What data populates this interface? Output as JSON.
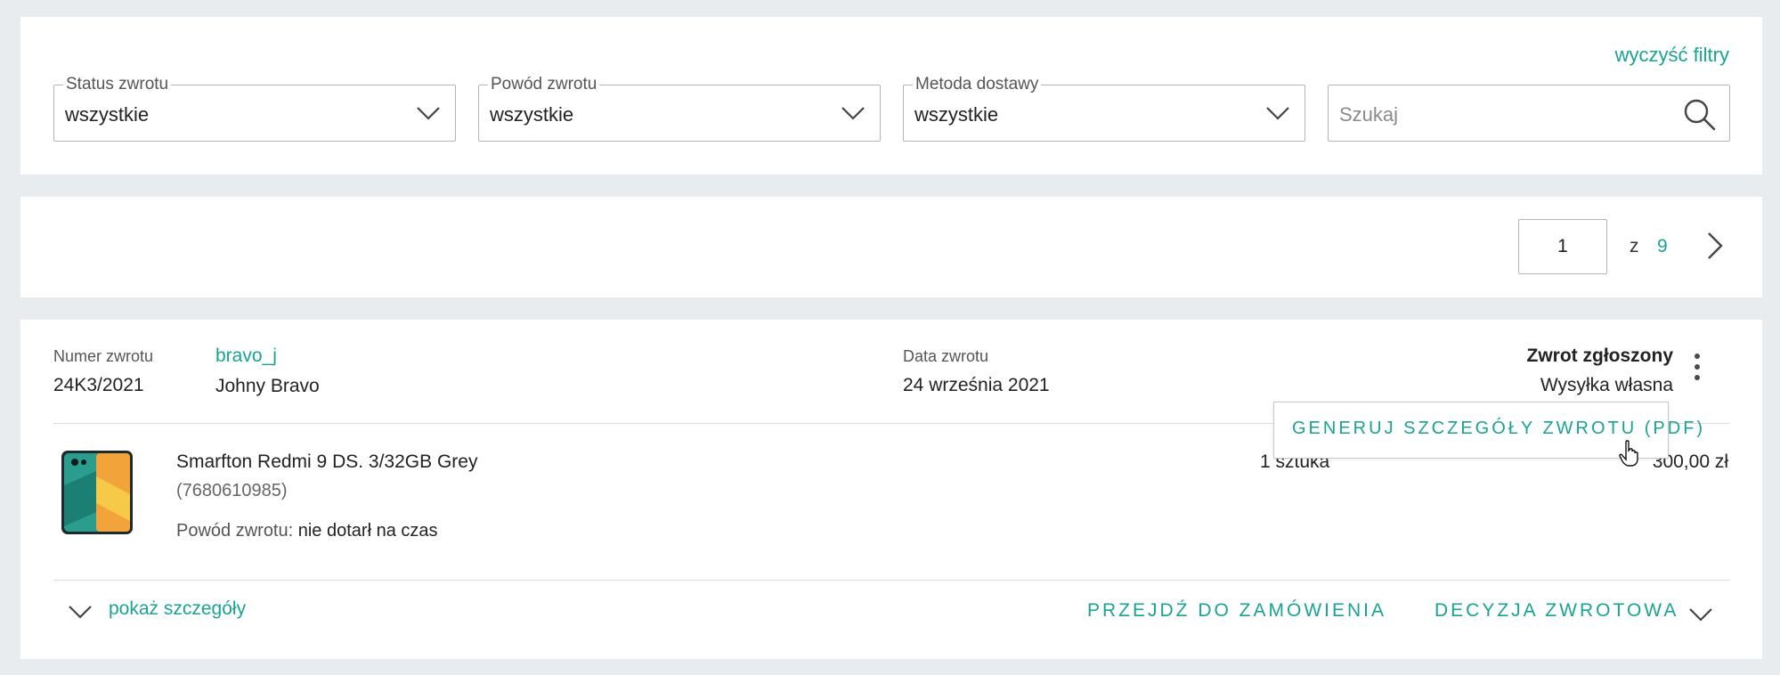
{
  "filters": {
    "clear_label": "wyczyść filtry",
    "status": {
      "label": "Status zwrotu",
      "value": "wszystkie"
    },
    "reason": {
      "label": "Powód zwrotu",
      "value": "wszystkie"
    },
    "delivery": {
      "label": "Metoda dostawy",
      "value": "wszystkie"
    },
    "search": {
      "placeholder": "Szukaj"
    }
  },
  "pagination": {
    "current": "1",
    "of_label": "z",
    "total": "9"
  },
  "return_item": {
    "number_label": "Numer zwrotu",
    "number": "24K3/2021",
    "username": "bravo_j",
    "customer_name": "Johny Bravo",
    "date_label": "Data zwrotu",
    "date": "24 września 2021",
    "status": "Zwrot zgłoszony",
    "shipping": "Wysyłka własna",
    "menu_item": "GENERUJ SZCZEGÓŁY ZWROTU (PDF)",
    "product": {
      "name": "Smarfton Redmi 9 DS. 3/32GB Grey",
      "id": "(7680610985)",
      "reason_label": "Powód zwrotu:",
      "reason": "nie dotarł na czas",
      "quantity": "1 sztuka",
      "price": "300,00 zł"
    },
    "show_details": "pokaż szczegóły",
    "go_to_order": "PRZEJDŹ DO ZAMÓWIENIA",
    "return_decision": "DECYZJA ZWROTOWA"
  },
  "colors": {
    "accent": "#1aa394",
    "background": "#e9ecef"
  }
}
